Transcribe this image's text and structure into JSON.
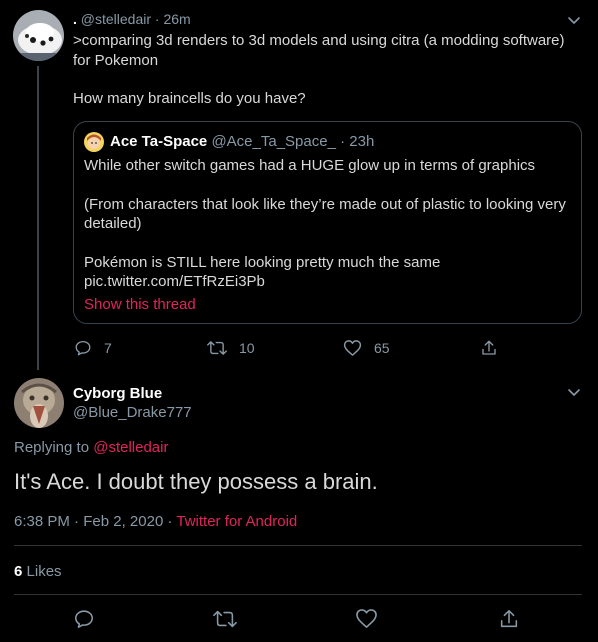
{
  "tweet1": {
    "display_name": ".",
    "handle": "@stelledair",
    "separator": "·",
    "time": "26m",
    "line1": ">comparing 3d renders to 3d models and using citra (a modding software) for Pokemon",
    "line2": "How many braincells do you have?",
    "reply_count": "7",
    "retweet_count": "10",
    "like_count": "65"
  },
  "quote": {
    "display_name": "Ace Ta-Space",
    "handle": "@Ace_Ta_Space_",
    "separator": "·",
    "time": "23h",
    "p1": "While other switch games had a HUGE glow up in terms of graphics",
    "p2": "(From characters that look like they’re made out of plastic to looking very detailed)",
    "p3a": "Pokémon is STILL here looking pretty much the same",
    "p3b": "pic.twitter.com/ETfRzEi3Pb",
    "show_thread": "Show this thread"
  },
  "tweet2": {
    "display_name": "Cyborg Blue",
    "handle": "@Blue_Drake777",
    "replying_prefix": "Replying to",
    "replying_handle": "@stelledair",
    "text": "It's Ace. I doubt they possess a brain.",
    "time": "6:38 PM",
    "date": "Feb 2, 2020",
    "separator": "·",
    "source": "Twitter for Android",
    "like_count": "6",
    "like_label": "Likes"
  },
  "icons": {
    "reply": "reply-icon",
    "retweet": "retweet-icon",
    "like": "heart-icon",
    "share": "share-icon",
    "caret": "chevron-down-icon"
  },
  "colors": {
    "background": "#000000",
    "text": "#d9d9d9",
    "muted": "#8899a6",
    "accent": "#e0245e",
    "border": "#38444d"
  }
}
